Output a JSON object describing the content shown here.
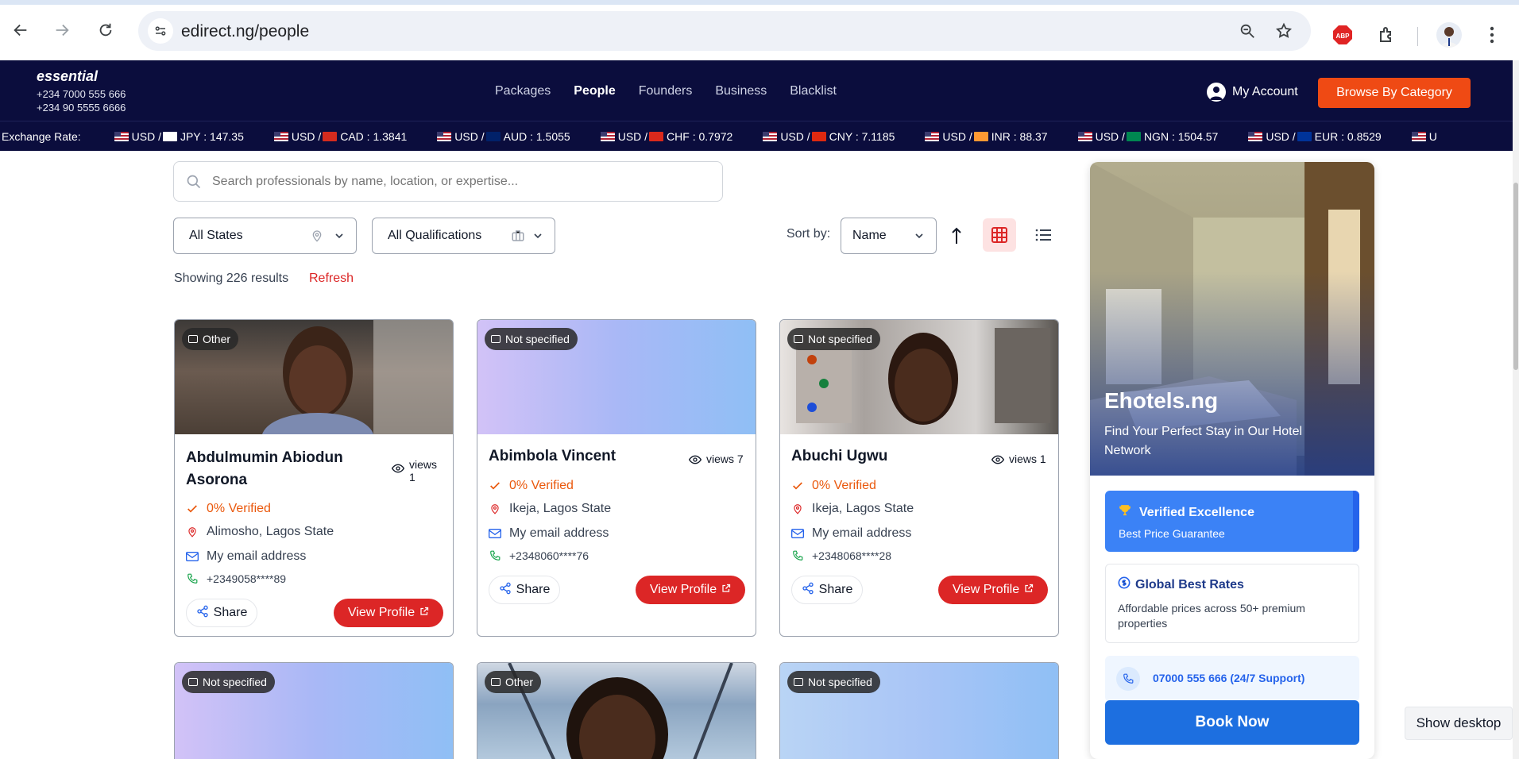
{
  "browser": {
    "url": "edirect.ng/people"
  },
  "header": {
    "brand": "essential",
    "phone1": "+234 7000 555 666",
    "phone2": "+234 90 5555 6666",
    "nav": [
      "Packages",
      "People",
      "Founders",
      "Business",
      "Blacklist"
    ],
    "active_nav": "People",
    "account_label": "My Account",
    "browse_label": "Browse By Category",
    "exchange_label": "Exchange Rate:",
    "rates": [
      {
        "pair": "USD / ",
        "target": "JPY : 147.35",
        "flag": "#ffffff"
      },
      {
        "pair": "USD / ",
        "target": "CAD : 1.3841",
        "flag": "#d52b1e"
      },
      {
        "pair": "USD / ",
        "target": "AUD : 1.5055",
        "flag": "#012169"
      },
      {
        "pair": "USD / ",
        "target": "CHF : 0.7972",
        "flag": "#da291c"
      },
      {
        "pair": "USD / ",
        "target": "CNY : 7.1185",
        "flag": "#de2910"
      },
      {
        "pair": "USD / ",
        "target": "INR : 88.37",
        "flag": "#ff9933"
      },
      {
        "pair": "USD / ",
        "target": "NGN : 1504.57",
        "flag": "#008751"
      },
      {
        "pair": "USD / ",
        "target": "EUR : 0.8529",
        "flag": "#003399"
      },
      {
        "pair": "U",
        "target": "",
        "flag": ""
      }
    ]
  },
  "filters": {
    "search_placeholder": "Search professionals by name, location, or expertise...",
    "state": "All States",
    "qualification": "All Qualifications",
    "sort_label": "Sort by:",
    "sort_value": "Name",
    "results": "Showing 226 results",
    "refresh": "Refresh"
  },
  "cards": [
    {
      "badge": "Other",
      "name1": "Abdulmumin Abiodun",
      "name2": "Asorona",
      "views1": "views",
      "views2": "1",
      "verified": "0% Verified",
      "location": "Alimosho, Lagos State",
      "email": "My email address",
      "phone": "+2349058****89",
      "share": "Share",
      "view": "View Profile"
    },
    {
      "badge": "Not specified",
      "name1": "Abimbola Vincent",
      "views1": "views 7",
      "verified": "0% Verified",
      "location": "Ikeja, Lagos State",
      "email": "My email address",
      "phone": "+2348060****76",
      "share": "Share",
      "view": "View Profile"
    },
    {
      "badge": "Not specified",
      "name1": "Abuchi Ugwu",
      "views1": "views 1",
      "verified": "0% Verified",
      "location": "Ikeja, Lagos State",
      "email": "My email address",
      "phone": "+2348068****28",
      "share": "Share",
      "view": "View Profile"
    },
    {
      "badge": "Not specified"
    },
    {
      "badge": "Other"
    },
    {
      "badge": "Not specified"
    }
  ],
  "ad": {
    "title": "Ehotels.ng",
    "subtitle": "Find Your Perfect Stay in Our Hotel Network",
    "feature1_title": "Verified Excellence",
    "feature1_sub": "Best Price Guarantee",
    "feature2_title": "Global Best Rates",
    "feature2_sub": "Affordable prices across 50+ premium properties",
    "support": "07000 555 666 (24/7 Support)",
    "cta": "Book Now"
  },
  "show_desktop": "Show desktop",
  "colors": {
    "header_bg": "#0b0d3d",
    "accent_orange": "#ef4a14",
    "accent_red": "#dc2626",
    "verified_orange": "#ea580c",
    "ad_blue": "#2563eb"
  }
}
